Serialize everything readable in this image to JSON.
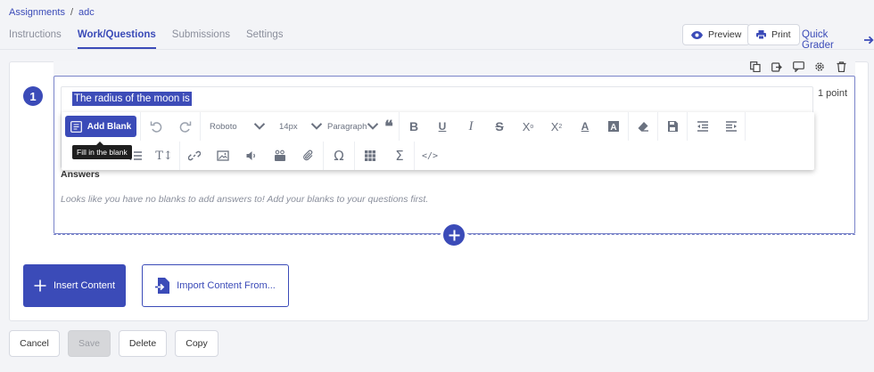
{
  "breadcrumb": {
    "root": "Assignments",
    "separator": "/",
    "current": "adc"
  },
  "tabs": [
    {
      "label": "Instructions"
    },
    {
      "label": "Work/Questions"
    },
    {
      "label": "Submissions"
    },
    {
      "label": "Settings"
    }
  ],
  "header": {
    "preview": "Preview",
    "print": "Print",
    "quick_grader": "Quick Grader"
  },
  "question": {
    "number": "1",
    "text": "The radius of the moon is",
    "points": "1 point",
    "answers_label": "Answers",
    "no_blanks_message": "Looks like you have no blanks to add answers to! Add your blanks to your questions first."
  },
  "toolbar": {
    "add_blank": "Add Blank",
    "tooltip": "Fill in the blank",
    "font": "Roboto",
    "size": "14px",
    "block": "Paragraph"
  },
  "actions": {
    "insert_content": "Insert Content",
    "import_content": "Import Content From..."
  },
  "footer": {
    "cancel": "Cancel",
    "save": "Save",
    "delete": "Delete",
    "copy": "Copy"
  },
  "colors": {
    "accent": "#3b4bb8",
    "icon": "#6b7280"
  }
}
